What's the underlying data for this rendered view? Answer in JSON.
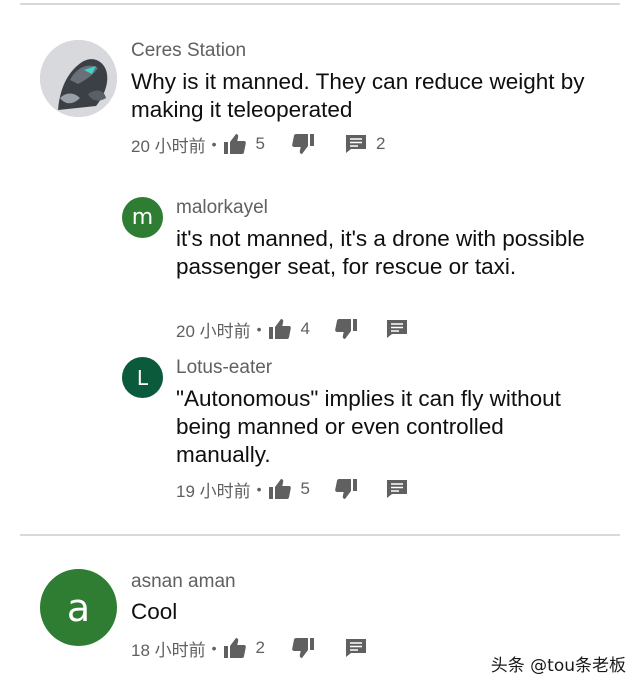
{
  "comments": [
    {
      "author": "Ceres Station",
      "text": "Why is it manned. They can reduce weight by making it teleoperated",
      "time": "20 小时前",
      "likes": "5",
      "replies": "2",
      "avatar_type": "image"
    }
  ],
  "replies": [
    {
      "author": "malorkayel",
      "text": "it's not manned, it's a drone with possible passenger seat, for rescue or taxi.",
      "time": "20 小时前",
      "likes": "4",
      "avatar_letter": "m",
      "avatar_color": "#2e7d32"
    },
    {
      "author": "Lotus-eater",
      "text": "\"Autonomous\" implies it can fly without being manned or even controlled manually.",
      "time": "19 小时前",
      "likes": "5",
      "avatar_letter": "L",
      "avatar_color": "#0b5a3c"
    }
  ],
  "second_comment": {
    "author": "asnan aman",
    "text": "Cool",
    "time": "18 小时前",
    "likes": "2",
    "avatar_letter": "a",
    "avatar_color": "#2e7d32"
  },
  "meta_separator": "•",
  "watermark": "头条 @tou条老板",
  "icons": [
    "thumbs-up-icon",
    "thumbs-down-icon",
    "reply-icon"
  ]
}
